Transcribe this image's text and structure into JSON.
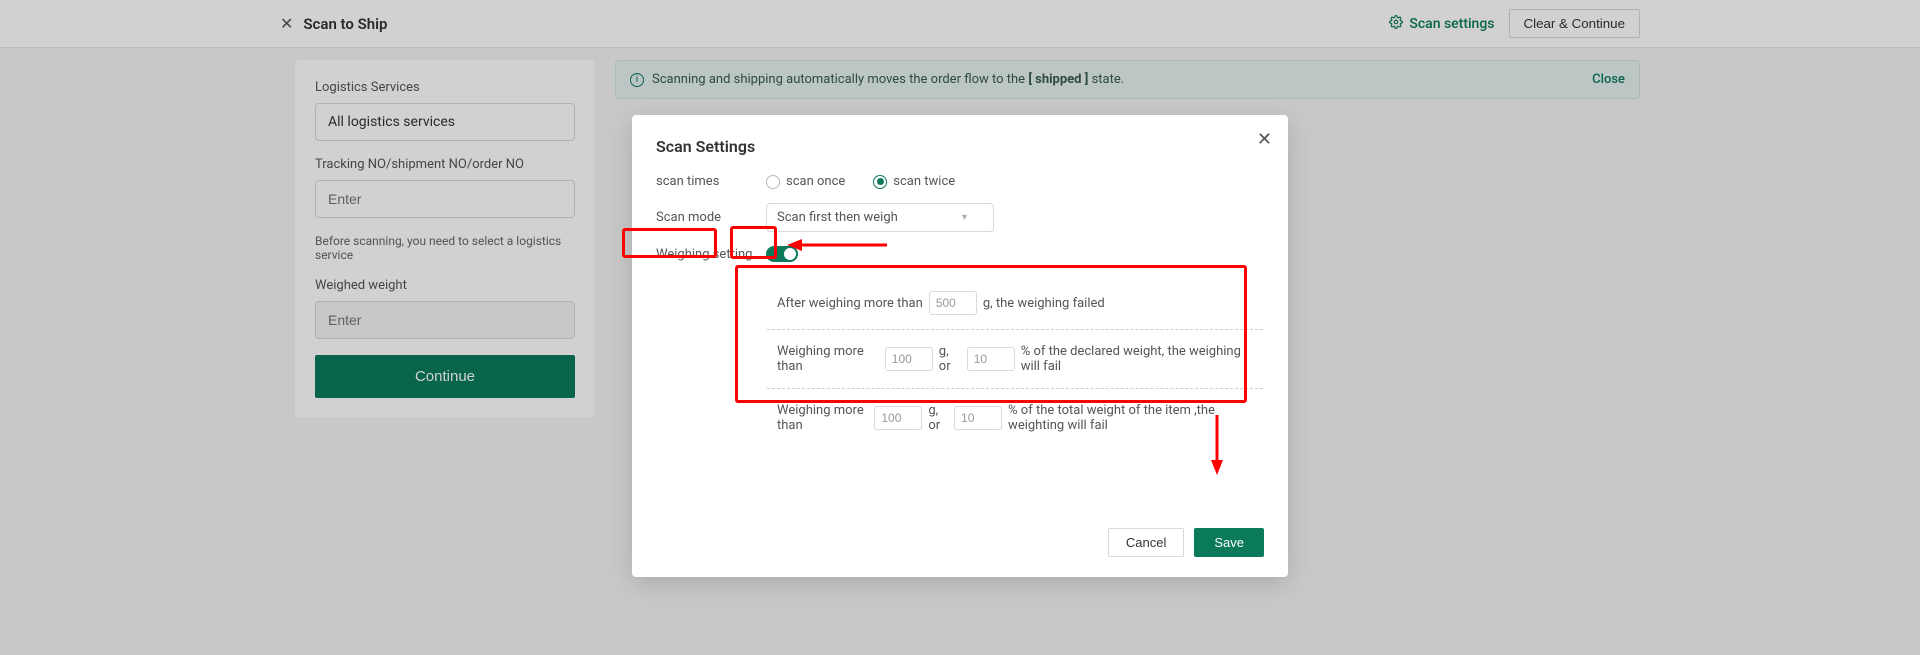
{
  "topbar": {
    "title": "Scan to Ship",
    "settings_link": "Scan settings",
    "clear_btn": "Clear & Continue"
  },
  "left": {
    "logistics_label": "Logistics Services",
    "logistics_value": "All logistics services",
    "tracking_label": "Tracking NO/shipment NO/order NO",
    "tracking_placeholder": "Enter",
    "hint": "Before scanning, you need to select a logistics service",
    "weighed_label": "Weighed weight",
    "weighed_placeholder": "Enter",
    "continue_btn": "Continue"
  },
  "banner": {
    "text_pre": "Scanning and shipping automatically moves the order flow to the",
    "state": "[ shipped ]",
    "text_post": "state.",
    "close": "Close"
  },
  "modal": {
    "title": "Scan Settings",
    "scan_times_label": "scan times",
    "scan_once": "scan once",
    "scan_twice": "scan twice",
    "scan_mode_label": "Scan mode",
    "scan_mode_value": "Scan first then weigh",
    "weighing_label": "Weighing setting",
    "rule1_pre": "After weighing more than",
    "rule1_val": "500",
    "rule1_post": "g, the weighing failed",
    "rule2_pre": "Weighing more than",
    "rule2_v1": "100",
    "rule2_mid": "g, or",
    "rule2_v2": "10",
    "rule2_post": "% of the declared weight, the weighing will fail",
    "rule3_pre": "Weighing more than",
    "rule3_v1": "100",
    "rule3_mid": "g, or",
    "rule3_v2": "10",
    "rule3_post": "% of the total weight of the item ,the weighting will fail",
    "cancel": "Cancel",
    "save": "Save"
  }
}
